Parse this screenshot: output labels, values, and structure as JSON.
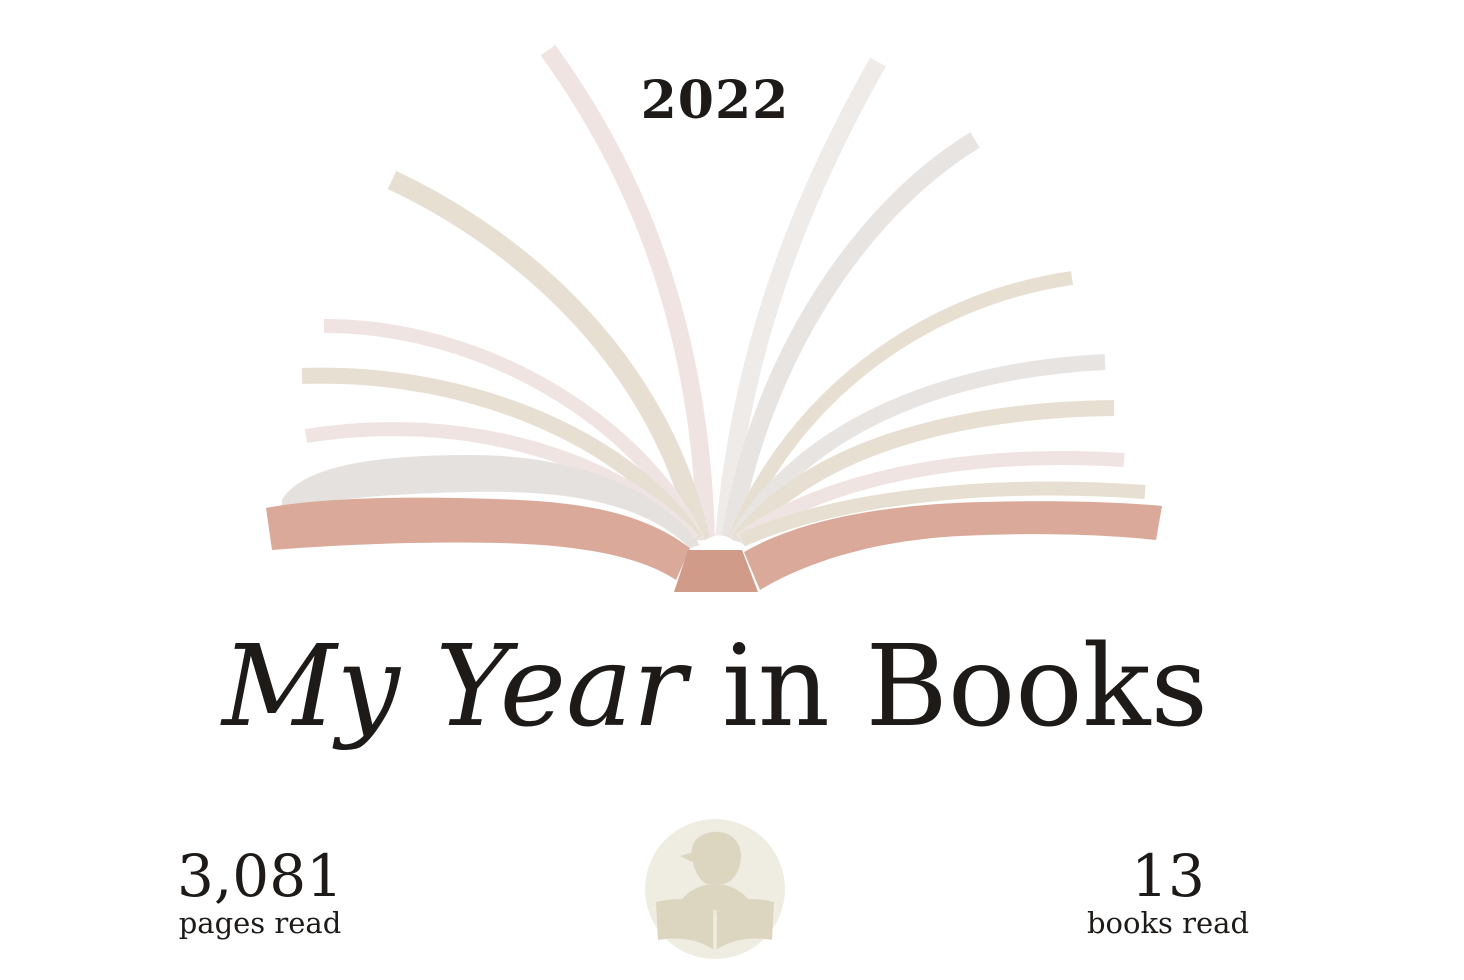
{
  "header": {
    "year": "2022"
  },
  "title": {
    "part1": "My",
    "part2": "Year",
    "part3": "in Books"
  },
  "stats": {
    "pages_value": "3,081",
    "pages_label": "pages read",
    "books_value": "13",
    "books_label": "books read"
  },
  "icons": {
    "illustration": "open-book-illustration",
    "avatar": "reader-avatar-icon"
  },
  "colors": {
    "text": "#1d1a18",
    "cover": "#dba99a",
    "page_beige": "#e7dfd2",
    "page_pink": "#f0e4e2",
    "page_gray": "#e8e4e1",
    "avatar_bg": "#efece2",
    "avatar_fg": "#dcd6c1"
  }
}
